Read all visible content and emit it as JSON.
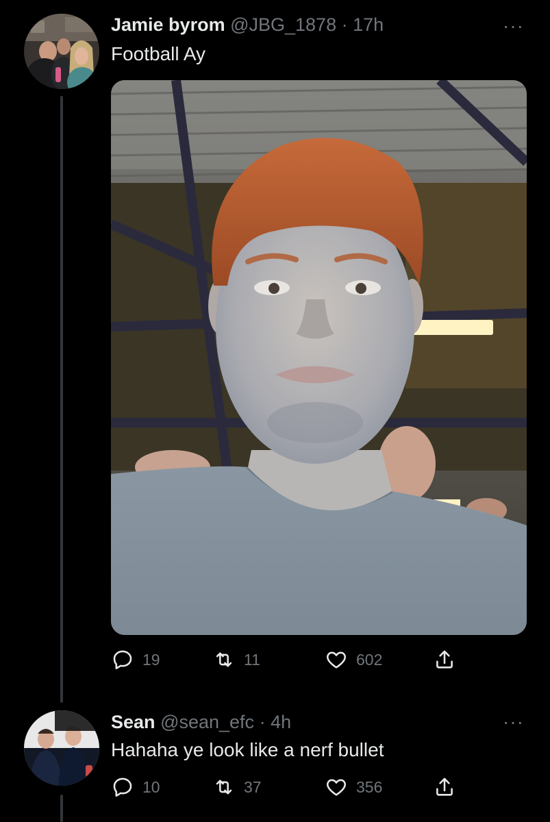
{
  "tweets": [
    {
      "name": "Jamie byrom",
      "handle": "@JBG_1878",
      "separator": "·",
      "time": "17h",
      "more": "···",
      "text": "Football Ay",
      "replies": "19",
      "retweets": "11",
      "likes": "602"
    },
    {
      "name": "Sean",
      "handle": "@sean_efc",
      "separator": "·",
      "time": "4h",
      "more": "···",
      "text": "Hahaha ye look like a nerf bullet",
      "replies": "10",
      "retweets": "37",
      "likes": "356"
    }
  ],
  "icons": {
    "reply": "reply-icon",
    "retweet": "retweet-icon",
    "like": "heart-icon",
    "share": "share-icon",
    "more": "more-icon"
  },
  "colors": {
    "background": "#000000",
    "primary_text": "#e7e9ea",
    "secondary_text": "#71767b",
    "thread_line": "#333639"
  }
}
